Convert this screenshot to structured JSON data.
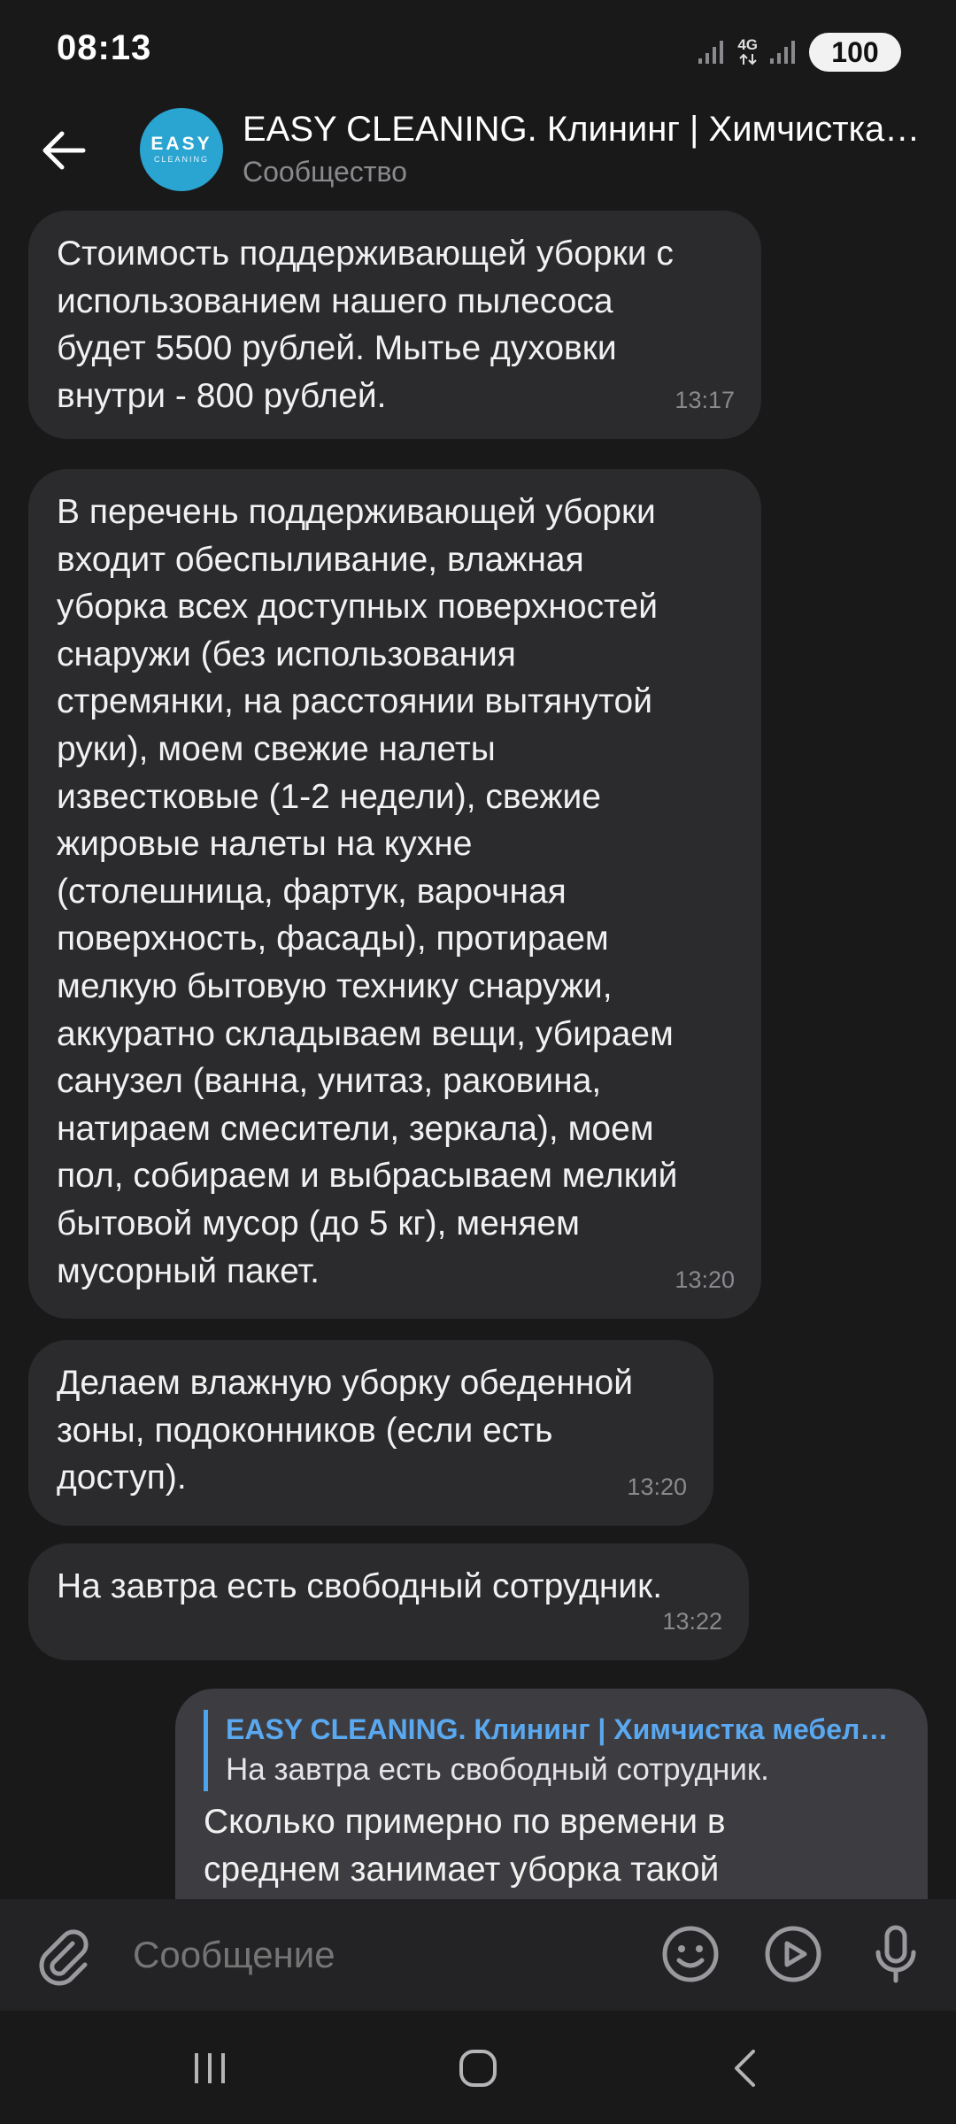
{
  "status_bar": {
    "time": "08:13",
    "network_label": "4G",
    "battery": "100"
  },
  "header": {
    "avatar_line1": "EASY",
    "avatar_line2": "CLEANING",
    "title": "EASY CLEANING. Клининг | Химчистка…",
    "subtitle": "Сообщество"
  },
  "messages": [
    {
      "text": "Стоимость поддерживающей уборки с\nиспользованием нашего пылесоса\nбудет 5500 рублей. Мытье духовки\nвнутри - 800 рублей.",
      "time": "13:17"
    },
    {
      "text": "В перечень поддерживающей уборки\nвходит обеспыливание, влажная\nуборка всех доступных поверхностей\nснаружи (без использования\nстремянки, на расстоянии вытянутой\nруки), моем свежие налеты\nизвестковые (1-2 недели), свежие\nжировые налеты на кухне\n(столешница, фартук, варочная\nповерхность, фасады), протираем\nмелкую бытовую технику снаружи,\nаккуратно складываем вещи, убираем\nсанузел (ванна, унитаз, раковина,\nнатираем смесители, зеркала), моем\nпол, собираем и выбрасываем мелкий\nбытовой мусор (до 5 кг), меняем\nмусорный пакет.",
      "time": "13:20"
    },
    {
      "text": "Делаем влажную уборку обеденной\nзоны, подоконников (если есть\nдоступ).",
      "time": "13:20"
    },
    {
      "text": "На завтра есть свободный сотрудник.",
      "time": "13:22"
    }
  ],
  "outgoing": {
    "reply_author": "EASY CLEANING. Клининг | Химчистка мебел…",
    "reply_text": "На завтра есть свободный сотрудник.",
    "text": "Сколько примерно по времени в\nсреднем занимает уборка такой"
  },
  "composer": {
    "placeholder": "Сообщение"
  },
  "colors": {
    "background": "#19191a",
    "bubble_incoming": "#2b2b2e",
    "bubble_outgoing": "#3d3d41",
    "accent": "#4ea3ef",
    "avatar": "#2aa4d0"
  },
  "icons": {
    "back": "arrow-left-icon",
    "attach": "paperclip-icon",
    "emoji": "smiley-icon",
    "video": "video-message-icon",
    "mic": "microphone-icon",
    "recents": "recent-apps-icon",
    "home": "home-icon",
    "nav_back": "chevron-left-icon"
  }
}
